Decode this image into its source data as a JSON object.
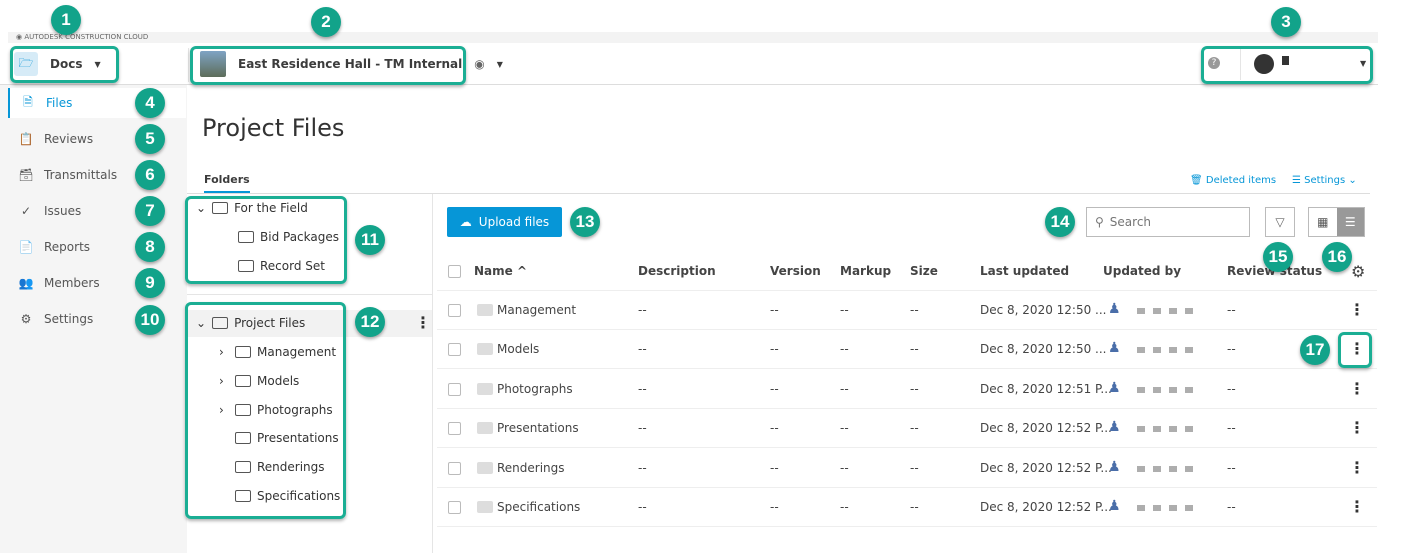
{
  "brand": "AUTODESK CONSTRUCTION CLOUD",
  "module": {
    "label": "Docs",
    "icon": "docs-folder-icon"
  },
  "project": {
    "name": "East Residence Hall - TM Internal"
  },
  "user": {
    "help_icon": "help-icon"
  },
  "sidebar": {
    "items": [
      {
        "label": "Files",
        "icon": "file-icon"
      },
      {
        "label": "Reviews",
        "icon": "reviews-icon"
      },
      {
        "label": "Transmittals",
        "icon": "transmittals-icon"
      },
      {
        "label": "Issues",
        "icon": "issues-icon"
      },
      {
        "label": "Reports",
        "icon": "reports-icon"
      },
      {
        "label": "Members",
        "icon": "members-icon"
      },
      {
        "label": "Settings",
        "icon": "settings-icon"
      }
    ]
  },
  "page": {
    "title": "Project Files",
    "tab": "Folders",
    "deleted_items": "Deleted items",
    "settings": "Settings"
  },
  "tree": {
    "field_root": "For the Field",
    "field_children": [
      "Bid Packages",
      "Record Set"
    ],
    "project_root": "Project Files",
    "project_children": [
      {
        "name": "Management",
        "expandable": true
      },
      {
        "name": "Models",
        "expandable": true
      },
      {
        "name": "Photographs",
        "expandable": true
      },
      {
        "name": "Presentations",
        "expandable": false
      },
      {
        "name": "Renderings",
        "expandable": false
      },
      {
        "name": "Specifications",
        "expandable": false
      }
    ]
  },
  "toolbar": {
    "upload": "Upload files",
    "search_placeholder": "Search"
  },
  "table": {
    "headers": [
      "Name ^",
      "Description",
      "Version",
      "Markup",
      "Size",
      "Last updated",
      "Updated by",
      "Review status"
    ],
    "rows": [
      {
        "name": "Management",
        "description": "--",
        "version": "--",
        "markup": "--",
        "size": "--",
        "updated": "Dec 8, 2020 12:50 ...",
        "review": "--"
      },
      {
        "name": "Models",
        "description": "--",
        "version": "--",
        "markup": "--",
        "size": "--",
        "updated": "Dec 8, 2020 12:50 ...",
        "review": "--"
      },
      {
        "name": "Photographs",
        "description": "--",
        "version": "--",
        "markup": "--",
        "size": "--",
        "updated": "Dec 8, 2020 12:51 P...",
        "review": "--"
      },
      {
        "name": "Presentations",
        "description": "--",
        "version": "--",
        "markup": "--",
        "size": "--",
        "updated": "Dec 8, 2020 12:52 P...",
        "review": "--"
      },
      {
        "name": "Renderings",
        "description": "--",
        "version": "--",
        "markup": "--",
        "size": "--",
        "updated": "Dec 8, 2020 12:52 P...",
        "review": "--"
      },
      {
        "name": "Specifications",
        "description": "--",
        "version": "--",
        "markup": "--",
        "size": "--",
        "updated": "Dec 8, 2020 12:52 P...",
        "review": "--"
      }
    ]
  },
  "callouts": [
    "1",
    "2",
    "3",
    "4",
    "5",
    "6",
    "7",
    "8",
    "9",
    "10",
    "11",
    "12",
    "13",
    "14",
    "15",
    "16",
    "17"
  ],
  "colors": {
    "accent": "#0696d7",
    "callout": "#12a38a"
  }
}
